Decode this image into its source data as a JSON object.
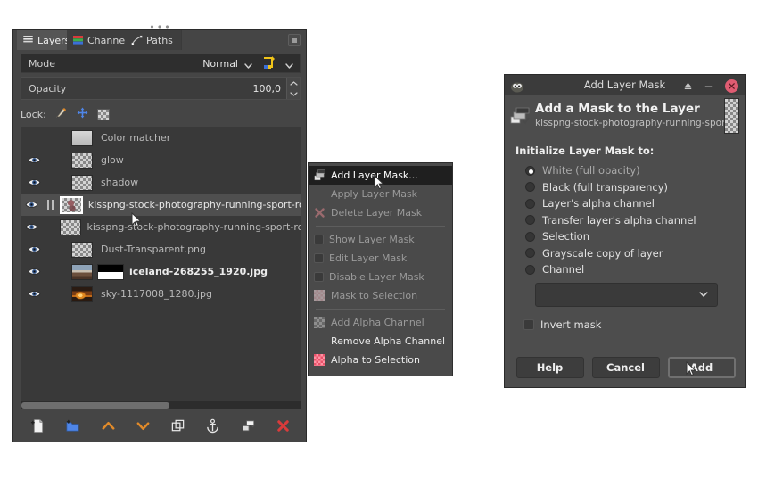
{
  "dock": {
    "tabs": [
      {
        "label": "Layers",
        "icon": "layers-icon",
        "active": true
      },
      {
        "label": "Channels",
        "icon": "channels-icon",
        "active": false
      },
      {
        "label": "Paths",
        "icon": "paths-icon",
        "active": false
      }
    ],
    "menu_button": "dock-menu-icon",
    "mode": {
      "label": "Mode",
      "value": "Normal",
      "blend_space_icon": "blend-space-icon"
    },
    "opacity": {
      "label": "Opacity",
      "value": "100,0"
    },
    "lock": {
      "label": "Lock:",
      "items": [
        {
          "name": "lock-pixels-icon"
        },
        {
          "name": "lock-position-icon"
        },
        {
          "name": "lock-alpha-icon"
        }
      ]
    },
    "layers": [
      {
        "name": "Color matcher",
        "visible": false,
        "thumb": "solid-gray",
        "selected": false,
        "bold": false,
        "mask": false,
        "linked": false
      },
      {
        "name": "glow",
        "visible": true,
        "thumb": "checker",
        "selected": false,
        "bold": false,
        "mask": false,
        "linked": false
      },
      {
        "name": "shadow",
        "visible": true,
        "thumb": "checker",
        "selected": false,
        "bold": false,
        "mask": false,
        "linked": false
      },
      {
        "name": "kisspng-stock-photography-running-sport-royalty-free",
        "visible": true,
        "thumb": "photo-runner",
        "selected": true,
        "bold": false,
        "mask": false,
        "linked": true
      },
      {
        "name": "kisspng-stock-photography-running-sport-royalty-free",
        "visible": true,
        "thumb": "checker",
        "selected": false,
        "bold": false,
        "mask": false,
        "linked": false
      },
      {
        "name": "Dust-Transparent.png",
        "visible": true,
        "thumb": "checker",
        "selected": false,
        "bold": false,
        "mask": false,
        "linked": false
      },
      {
        "name": "iceland-268255_1920.jpg",
        "visible": true,
        "thumb": "photo-iceland",
        "selected": false,
        "bold": true,
        "mask": true,
        "linked": false
      },
      {
        "name": "sky-1117008_1280.jpg",
        "visible": true,
        "thumb": "photo-sky",
        "selected": false,
        "bold": false,
        "mask": false,
        "linked": false
      }
    ],
    "toolbar": [
      {
        "name": "new-layer-button",
        "icon": "new-layer-icon"
      },
      {
        "name": "new-layer-group-button",
        "icon": "new-layer-group-icon"
      },
      {
        "name": "raise-layer-button",
        "icon": "chevron-up-icon"
      },
      {
        "name": "lower-layer-button",
        "icon": "chevron-down-icon"
      },
      {
        "name": "duplicate-layer-button",
        "icon": "duplicate-layer-icon"
      },
      {
        "name": "anchor-layer-button",
        "icon": "anchor-icon"
      },
      {
        "name": "merge-down-button",
        "icon": "merge-down-icon"
      },
      {
        "name": "delete-layer-button",
        "icon": "delete-layer-icon"
      }
    ]
  },
  "context_menu": {
    "items": [
      {
        "label": "Add Layer Mask...",
        "state": "highlight",
        "icon": "add-layer-mask-icon",
        "type": "item"
      },
      {
        "label": "Apply Layer Mask",
        "state": "disabled",
        "icon": "none",
        "type": "item"
      },
      {
        "label": "Delete Layer Mask",
        "state": "disabled",
        "icon": "delete-mask-icon",
        "type": "item"
      },
      {
        "type": "separator"
      },
      {
        "label": "Show Layer Mask",
        "state": "disabled",
        "icon": "checkbox",
        "type": "check"
      },
      {
        "label": "Edit Layer Mask",
        "state": "disabled",
        "icon": "checkbox",
        "type": "check"
      },
      {
        "label": "Disable Layer Mask",
        "state": "disabled",
        "icon": "checkbox",
        "type": "check"
      },
      {
        "label": "Mask to Selection",
        "state": "disabled",
        "icon": "mask-to-selection-icon",
        "type": "item"
      },
      {
        "type": "separator"
      },
      {
        "label": "Add Alpha Channel",
        "state": "disabled",
        "icon": "add-alpha-icon",
        "type": "item"
      },
      {
        "label": "Remove Alpha Channel",
        "state": "enabled",
        "icon": "none",
        "type": "item"
      },
      {
        "label": "Alpha to Selection",
        "state": "enabled",
        "icon": "alpha-to-selection-icon",
        "type": "item"
      }
    ]
  },
  "dialog": {
    "title": "Add Layer Mask",
    "titlebar_buttons": [
      {
        "name": "shade-button",
        "icon": "shade-icon"
      },
      {
        "name": "minimize-button",
        "icon": "minimize-icon"
      },
      {
        "name": "close-button",
        "icon": "close-icon"
      }
    ],
    "heading": "Add a Mask to the Layer",
    "subheading": "kisspng-stock-photography-running-spor...",
    "init_label": "Initialize Layer Mask to:",
    "options": [
      {
        "label": "White (full opacity)",
        "checked": true
      },
      {
        "label": "Black (full transparency)",
        "checked": false
      },
      {
        "label": "Layer's alpha channel",
        "checked": false
      },
      {
        "label": "Transfer layer's alpha channel",
        "checked": false
      },
      {
        "label": "Selection",
        "checked": false
      },
      {
        "label": "Grayscale copy of layer",
        "checked": false
      },
      {
        "label": "Channel",
        "checked": false
      }
    ],
    "channel_combo": {
      "value": "",
      "icon": "chevron-down-icon"
    },
    "invert": {
      "label": "Invert mask",
      "checked": false
    },
    "buttons": [
      {
        "label": "Help",
        "default": false
      },
      {
        "label": "Cancel",
        "default": false
      },
      {
        "label": "Add",
        "default": true
      }
    ]
  },
  "colors": {
    "dock_bg": "#454545",
    "list_bg": "#393939",
    "selected_row": "#4f4f4f",
    "menu_bg": "#4a4a4a",
    "menu_highlight": "#1f1f1f",
    "dialog_bg": "#4d4d4d",
    "titlebar_bg": "#3b3b3b",
    "close_red": "#e05c72",
    "accent_orange": "#e08a2a",
    "delete_red": "#d93b3b"
  }
}
